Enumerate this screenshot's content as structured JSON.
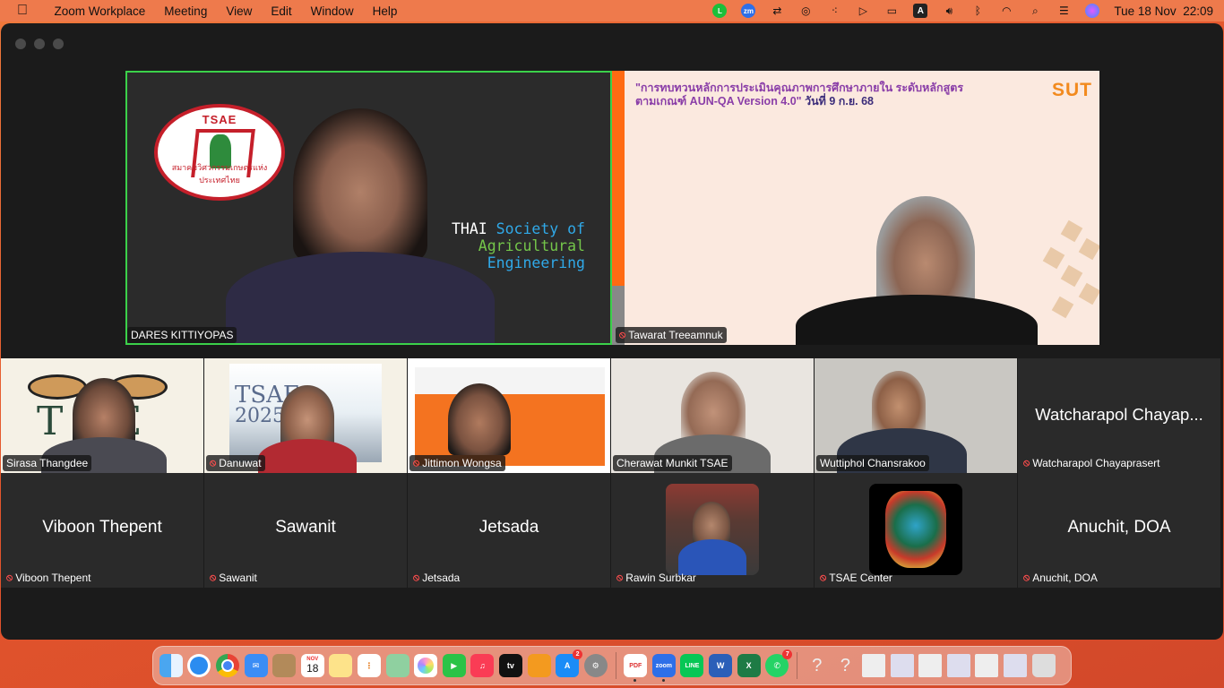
{
  "menubar": {
    "app_name": "Zoom Workplace",
    "items": [
      "Meeting",
      "View",
      "Edit",
      "Window",
      "Help"
    ],
    "date": "Tue 18 Nov",
    "time": "22:09",
    "tray_icons": [
      "line-icon",
      "zoom-icon",
      "screen-mirror-icon",
      "airdrop-icon",
      "dots-icon",
      "play-icon",
      "battery-icon",
      "input-source-icon",
      "volume-icon",
      "bluetooth-icon",
      "wifi-icon",
      "search-icon",
      "control-center-icon",
      "siri-icon"
    ],
    "input_source_label": "A",
    "zoom_badge": "zm"
  },
  "speakers": {
    "left": {
      "name": "DARES KITTIYOPAS",
      "logo_text": "TSAE",
      "logo_subtext": "สมาคมวิศวกรรมเกษตรแห่งประเทศไทย",
      "bg_line1_white": "THAI",
      "bg_line1_blue": "Society of",
      "bg_line2": "Agricultural",
      "bg_line3": "Engineering"
    },
    "right": {
      "name": "Tawarat Treeamnuk",
      "slide_title_line1": "\"การทบทวนหลักการประเมินคุณภาพการศึกษาภายใน ระดับหลักสูตร",
      "slide_title_line2a": "ตามเกณฑ์ AUN-QA Version 4.0\"",
      "slide_title_line2b": "วันที่ 9 ก.ย. 68",
      "brand": "SUT"
    }
  },
  "row1": [
    {
      "name": "Sirasa Thangdee",
      "muted": false
    },
    {
      "name": "Danuwat",
      "muted": true
    },
    {
      "name": "Jittimon Wongsa",
      "muted": true
    },
    {
      "name": "Cherawat Munkit TSAE",
      "muted": false
    },
    {
      "name": "Wuttiphol Chansrakoo",
      "muted": false
    },
    {
      "name": "Watcharapol Chayaprasert",
      "display": "Watcharapol Chayap...",
      "muted": true
    }
  ],
  "row2": [
    {
      "name": "Viboon Thepent",
      "display": "Viboon Thepent",
      "muted": true
    },
    {
      "name": "Sawanit",
      "display": "Sawanit",
      "muted": true
    },
    {
      "name": "Jetsada",
      "display": "Jetsada",
      "muted": true
    },
    {
      "name": "Rawin Surbkar",
      "muted": true
    },
    {
      "name": "TSAE Center",
      "muted": true
    },
    {
      "name": "Anuchit, DOA",
      "display": "Anuchit, DOA",
      "muted": true
    }
  ],
  "dock": {
    "calendar_month": "NOV",
    "calendar_day": "18",
    "appstore_badge": "2",
    "whatsapp_badge": "7",
    "items": [
      "finder",
      "safari",
      "chrome",
      "mail",
      "notes-app",
      "calendar",
      "notes",
      "reminders",
      "maps",
      "photos",
      "facetime",
      "music",
      "apple-tv",
      "books",
      "app-store",
      "settings",
      "pdf",
      "zoom",
      "line",
      "word",
      "excel",
      "whatsapp",
      "help",
      "help",
      "preview-1",
      "preview-2",
      "preview-3",
      "preview-4",
      "preview-5",
      "preview-6",
      "trash"
    ],
    "pdf_label": "PDF",
    "zoom_label": "zoom",
    "line_label": "LINE",
    "word_label": "W",
    "excel_label": "X",
    "tv_label": "tv"
  }
}
